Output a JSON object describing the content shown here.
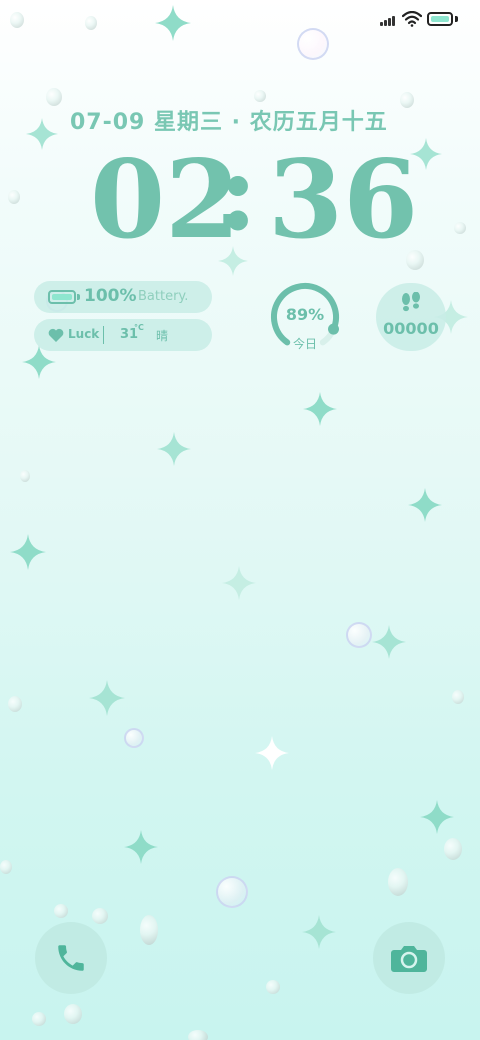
{
  "lockscreen": {
    "date_text": "07-09 星期三 · 农历五月十五",
    "clock": {
      "hour": "02",
      "separator": ":",
      "minute": "36"
    }
  },
  "widgets": {
    "battery": {
      "percent_text": "100%",
      "label": "Battery."
    },
    "weather": {
      "mood_label": "Luck",
      "temperature": "31",
      "unit": "°C",
      "condition": "晴"
    },
    "progress": {
      "value_text": "89%",
      "value": 0.89,
      "caption": "今日"
    },
    "steps": {
      "count": "00000"
    }
  },
  "status_bar": {
    "icons": [
      "signal-icon",
      "wifi-icon",
      "battery-icon"
    ],
    "battery_level": 1.0
  },
  "shortcuts": {
    "left": "phone-icon",
    "right": "camera-icon"
  },
  "colors": {
    "accent": "#72c2ad",
    "widget_bg": "#c8ece6",
    "battery_fill": "#8ee6cf"
  }
}
